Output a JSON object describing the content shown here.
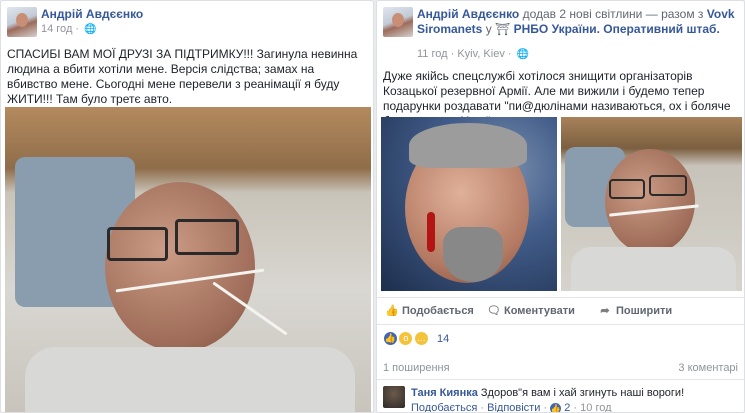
{
  "left_post": {
    "author": "Андрій Авдєєнко",
    "time": "14 год",
    "text": "СПАСИБІ ВАМ МОЇ ДРУЗІ ЗА ПІДТРИМКУ!!! Загинула невинна людина а вбити хотіли мене. Версія слідства; замах на вбивство мене. Сьогодні мене перевели з реанімації я буду ЖИТИ!!! Там було третє авто."
  },
  "right_post": {
    "author": "Андрій Авдєєнко",
    "added": "додав 2 нові світлини",
    "with_text": "— разом з",
    "tagged": "Vovk Siromanets",
    "in_text": "у",
    "place": "РНБО України. Оперативний штаб.",
    "time": "11 год",
    "location": "Kyiv, Kiev",
    "text": "Дуже якійсь спецслужбі хотілося знищити організаторів Козацької резервної Армії. Але ми вижили і будемо тепер подарунки роздавати \"пи@дюлінами називаються, ох і боляче буде ворогам України.",
    "actions": {
      "like": "Подобається",
      "comment": "Коментувати",
      "share": "Поширити"
    },
    "reactions_count": "14",
    "shares": "1 поширення",
    "comments_count": "3 коментарі",
    "comment": {
      "author": "Таня Киянка",
      "text": "Здоров\"я вам і хай згинуть наші вороги!",
      "like_label": "Подобається",
      "replies_label": "Відповісти",
      "likes": "2",
      "time": "10 год"
    }
  },
  "colors": {
    "link": "#365899",
    "meta": "#90949c",
    "background": "#e9ebee"
  }
}
